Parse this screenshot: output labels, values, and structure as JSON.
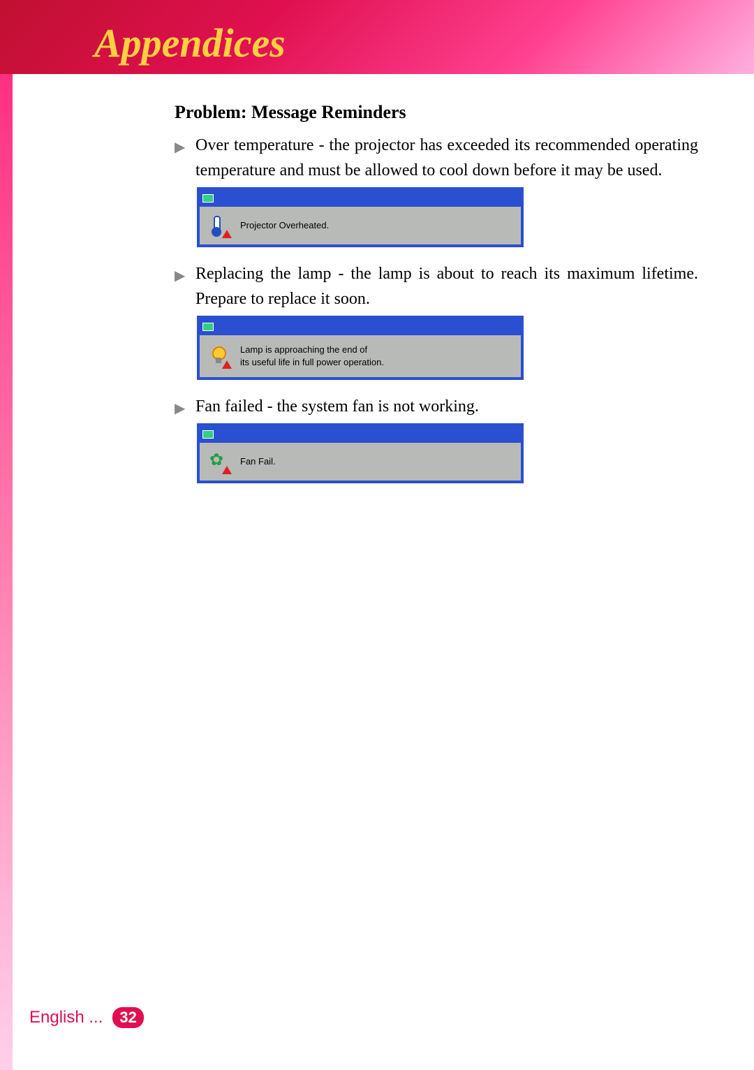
{
  "header": {
    "title": "Appendices"
  },
  "section": {
    "heading": "Problem: Message Reminders"
  },
  "items": [
    {
      "text": "Over temperature - the projector has exceeded its recommended operating temperature and must be allowed to cool down before it may be used.",
      "message": "Projector Overheated."
    },
    {
      "text": "Replacing the lamp - the lamp is about to reach its maximum lifetime. Prepare to replace  it soon.",
      "message": "Lamp is approaching the end of\nits useful life in full power operation."
    },
    {
      "text": "Fan failed - the system fan is not working.",
      "message": "Fan Fail."
    }
  ],
  "footer": {
    "language": "English ...",
    "page": "32"
  }
}
